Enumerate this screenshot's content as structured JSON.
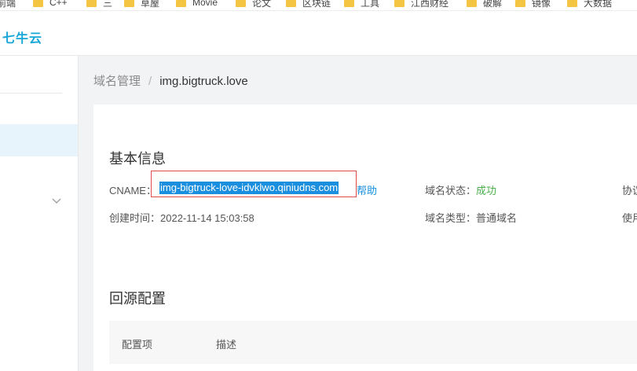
{
  "bookmarks": [
    {
      "label": "前端"
    },
    {
      "label": "C++"
    },
    {
      "label": "三"
    },
    {
      "label": "草屋"
    },
    {
      "label": "Movie"
    },
    {
      "label": "论文"
    },
    {
      "label": "区块链"
    },
    {
      "label": "工具"
    },
    {
      "label": "江西财经"
    },
    {
      "label": "破解"
    },
    {
      "label": "镜像"
    },
    {
      "label": "大数据"
    }
  ],
  "header": {
    "logo_text": "七牛云"
  },
  "breadcrumb": {
    "parent": "域名管理",
    "separator": "/",
    "current": "img.bigtruck.love"
  },
  "basic_info": {
    "title": "基本信息",
    "cname_label": "CNAME：",
    "cname_value": "img-bigtruck-love-idvklwo.qiniudns.com",
    "help_link": "帮助",
    "created_label": "创建时间：",
    "created_value": "2022-11-14 15:03:58",
    "status_label": "域名状态：",
    "status_value": "成功",
    "type_label": "域名类型：",
    "type_value": "普通域名",
    "right_col_1": "协议",
    "right_col_2": "使用"
  },
  "origin_config": {
    "title": "回源配置",
    "columns": [
      "配置项",
      "描述"
    ]
  },
  "colors": {
    "accent": "#1a8fdf",
    "success": "#4cae4c",
    "highlight_border": "#e04b4b"
  },
  "icons": {
    "sidebar_chevron": "chevron-down-icon",
    "bookmark_folder": "folder-icon"
  }
}
